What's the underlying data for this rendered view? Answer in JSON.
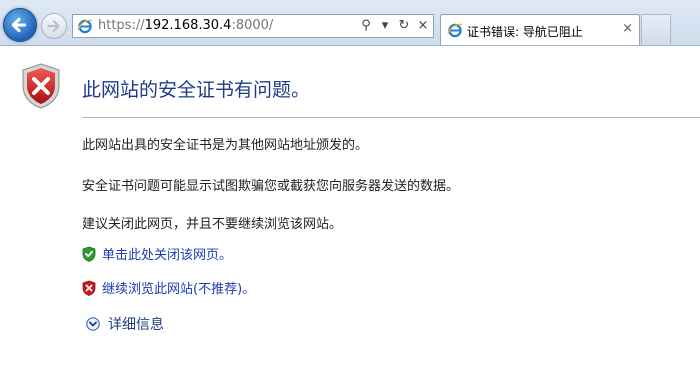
{
  "browser": {
    "address": {
      "scheme": "https://",
      "host": "192.168.30.4",
      "port": ":8000/"
    },
    "tab": {
      "title": "证书错误: 导航已阻止",
      "close_glyph": "×"
    },
    "address_tools": {
      "search_glyph": "⚲",
      "dropdown_glyph": "▾",
      "refresh_glyph": "↻",
      "stop_glyph": "×"
    }
  },
  "page": {
    "title": "此网站的安全证书有问题。",
    "paragraphs": [
      "此网站出具的安全证书是为其他网站地址颁发的。",
      "安全证书问题可能显示试图欺骗您或截获您向服务器发送的数据。",
      "建议关闭此网页，并且不要继续浏览该网站。"
    ],
    "actions": {
      "close_page": "单击此处关闭该网页。",
      "continue": "继续浏览此网站(不推荐)。"
    },
    "details_label": "详细信息"
  },
  "colors": {
    "accent": "#1f3c88",
    "link": "#1a3cb4",
    "danger": "#c8191b",
    "safe": "#2e9a2e"
  },
  "icons": {
    "back": "back-arrow-icon",
    "forward": "forward-arrow-icon",
    "browser": "ie-logo-icon",
    "error": "red-shield-x-icon",
    "ok": "green-shield-check-icon",
    "details": "chevron-down-circle-icon"
  }
}
